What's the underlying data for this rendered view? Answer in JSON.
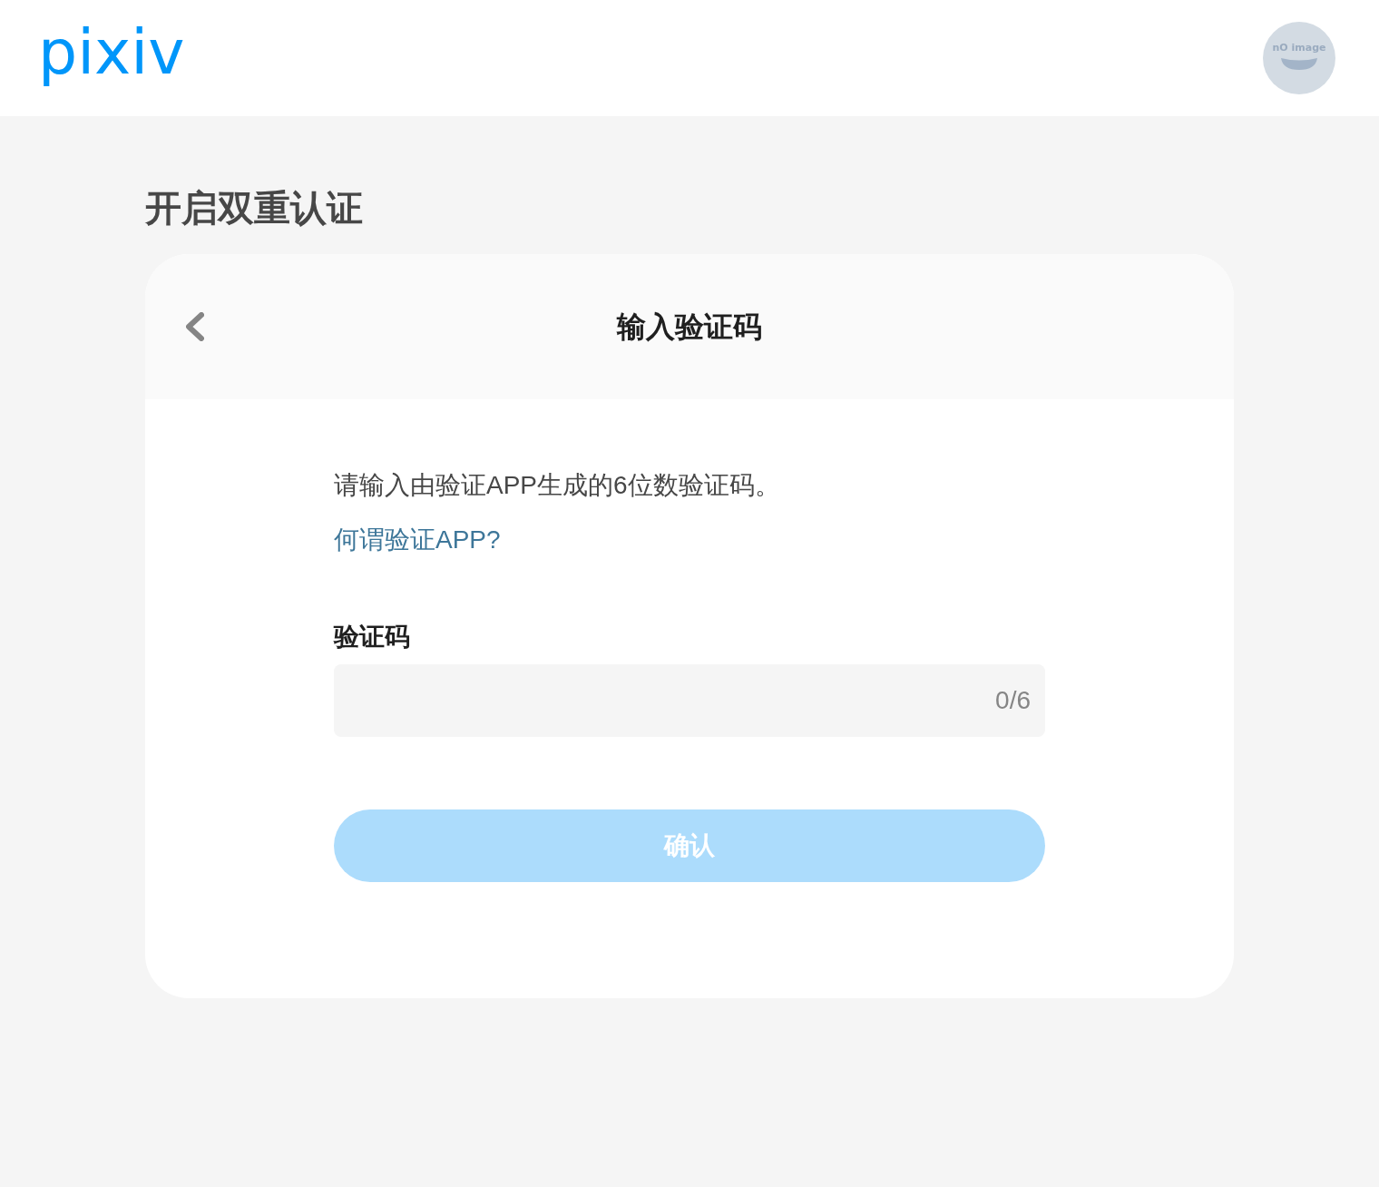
{
  "header": {
    "logo": "pixiv",
    "avatar": {
      "caption": "nO image"
    }
  },
  "page_title": "开启双重认证",
  "card": {
    "title": "输入验证码",
    "instruction": "请输入由验证APP生成的6位数验证码。",
    "help_link": "何谓验证APP?",
    "code_field": {
      "label": "验证码",
      "counter": "0/6"
    },
    "confirm_button": {
      "label": "确认",
      "disabled": true
    }
  }
}
